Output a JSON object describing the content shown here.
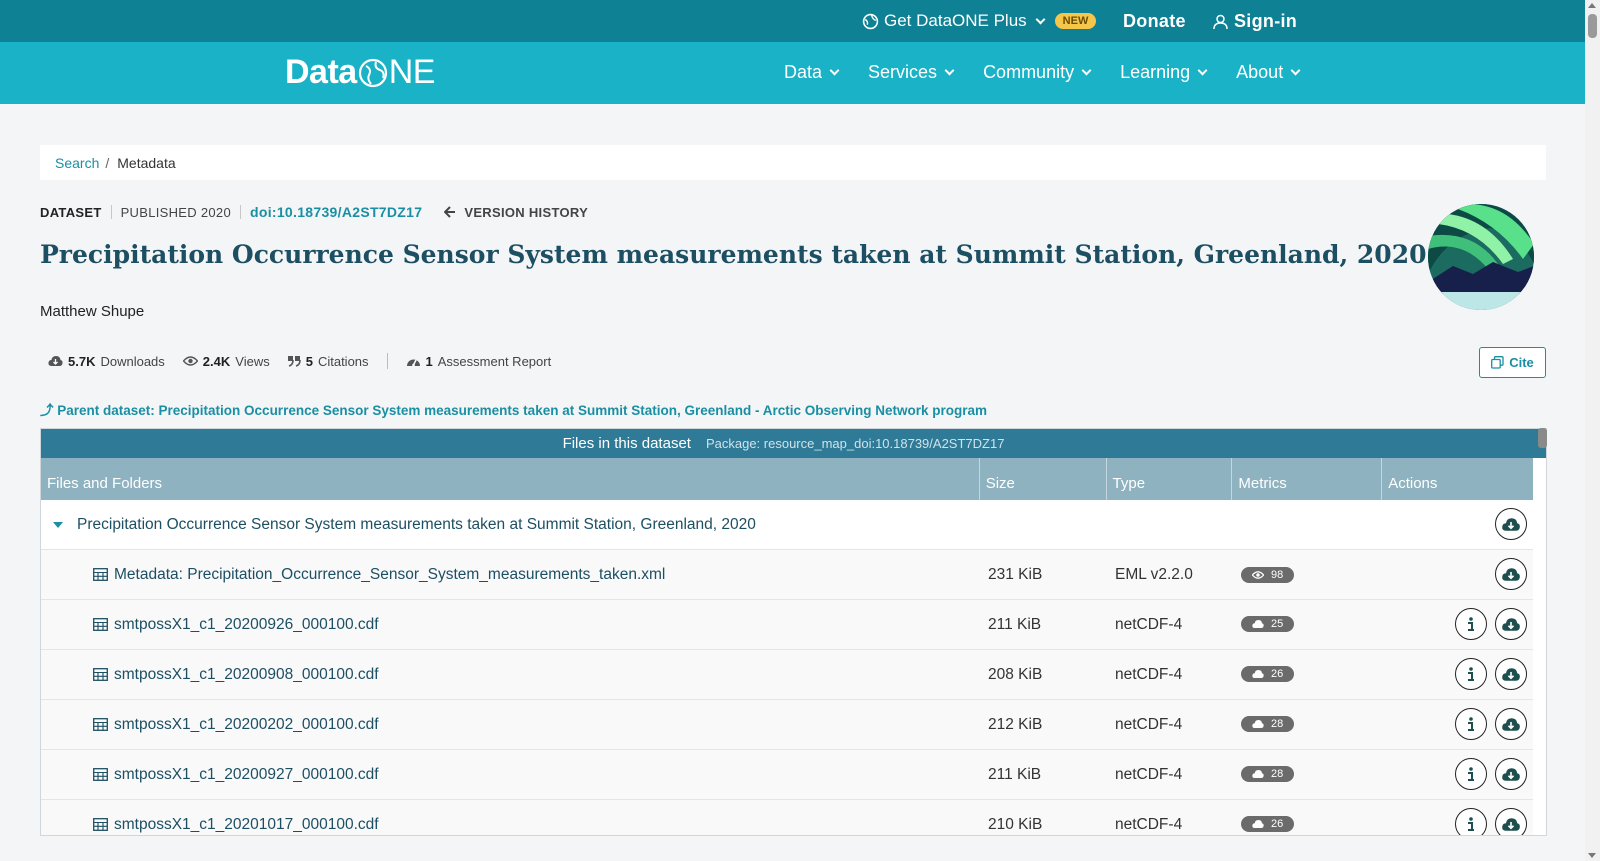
{
  "topbar": {
    "plus_label": "Get DataONE Plus",
    "new_badge": "NEW",
    "donate": "Donate",
    "signin": "Sign-in"
  },
  "logo": {
    "data": "Data",
    "one": "NE"
  },
  "nav": [
    "Data",
    "Services",
    "Community",
    "Learning",
    "About"
  ],
  "breadcrumb": {
    "search": "Search",
    "sep": "/",
    "current": "Metadata"
  },
  "dataset": {
    "type": "DATASET",
    "published": "PUBLISHED 2020",
    "doi": "doi:10.18739/A2ST7DZ17",
    "version_history": "VERSION HISTORY",
    "title": "Precipitation Occurrence Sensor System measurements taken at Summit Station, Greenland, 2020",
    "author": "Matthew Shupe"
  },
  "stats": {
    "downloads_num": "5.7K",
    "downloads_label": "Downloads",
    "views_num": "2.4K",
    "views_label": "Views",
    "citations_num": "5",
    "citations_label": "Citations",
    "assess_num": "1",
    "assess_label": "Assessment Report"
  },
  "cite_label": "Cite",
  "parent": "⤴ Parent dataset: Precipitation Occurrence Sensor System measurements taken at Summit Station, Greenland - Arctic Observing Network program",
  "files": {
    "title": "Files in this dataset",
    "package": "Package: resource_map_doi:10.18739/A2ST7DZ17",
    "columns": [
      "Files and Folders",
      "Size",
      "Type",
      "Metrics",
      "Actions"
    ],
    "package_row": "Precipitation Occurrence Sensor System measurements taken at Summit Station, Greenland, 2020",
    "rows": [
      {
        "name": "Metadata: Precipitation_Occurrence_Sensor_System_measurements_taken.xml",
        "size": "231 KiB",
        "type": "EML v2.2.0",
        "metric": "98",
        "metric_icon": "eye-icon"
      },
      {
        "name": "smtpossX1_c1_20200926_000100.cdf",
        "size": "211 KiB",
        "type": "netCDF-4",
        "metric": "25",
        "metric_icon": "cloud-download-icon"
      },
      {
        "name": "smtpossX1_c1_20200908_000100.cdf",
        "size": "208 KiB",
        "type": "netCDF-4",
        "metric": "26",
        "metric_icon": "cloud-download-icon"
      },
      {
        "name": "smtpossX1_c1_20200202_000100.cdf",
        "size": "212 KiB",
        "type": "netCDF-4",
        "metric": "28",
        "metric_icon": "cloud-download-icon"
      },
      {
        "name": "smtpossX1_c1_20200927_000100.cdf",
        "size": "211 KiB",
        "type": "netCDF-4",
        "metric": "28",
        "metric_icon": "cloud-download-icon"
      },
      {
        "name": "smtpossX1_c1_20201017_000100.cdf",
        "size": "210 KiB",
        "type": "netCDF-4",
        "metric": "26",
        "metric_icon": "cloud-download-icon"
      }
    ]
  },
  "colors": {
    "topbar": "#0f8194",
    "navbar": "#1ab2c6",
    "link": "#1a8fa3",
    "title": "#1d4f63",
    "table_head": "#2f7a97"
  }
}
